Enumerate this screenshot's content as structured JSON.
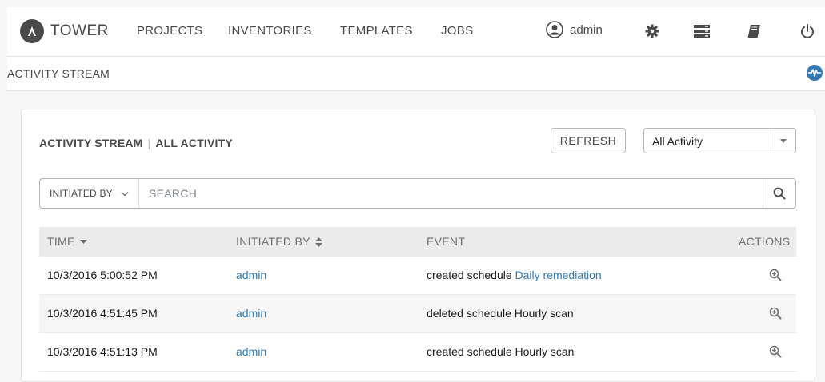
{
  "nav": {
    "brand": "TOWER",
    "links": [
      "PROJECTS",
      "INVENTORIES",
      "TEMPLATES",
      "JOBS"
    ],
    "user": "admin",
    "icons": [
      "settings-gear-icon",
      "server-stack-icon",
      "docs-book-icon",
      "power-icon"
    ]
  },
  "breadcrumb": {
    "label": "ACTIVITY STREAM",
    "activity_icon": "activity-pulse-icon"
  },
  "panel": {
    "title": "ACTIVITY STREAM",
    "subtitle": "ALL ACTIVITY",
    "refresh_label": "REFRESH",
    "filter_value": "All Activity"
  },
  "search": {
    "key_label": "INITIATED BY",
    "placeholder": "SEARCH"
  },
  "table": {
    "headers": {
      "time": "TIME",
      "initiated_by": "INITIATED BY",
      "event": "EVENT",
      "actions": "ACTIONS"
    },
    "rows": [
      {
        "time": "10/3/2016 5:00:52 PM",
        "user": "admin",
        "event_prefix": "created schedule",
        "event_link": "Daily remediation",
        "event_suffix": ""
      },
      {
        "time": "10/3/2016 4:51:45 PM",
        "user": "admin",
        "event_prefix": "deleted schedule Hourly scan",
        "event_link": "",
        "event_suffix": ""
      },
      {
        "time": "10/3/2016 4:51:13 PM",
        "user": "admin",
        "event_prefix": "created schedule Hourly scan",
        "event_link": "",
        "event_suffix": ""
      }
    ]
  },
  "colors": {
    "link": "#337ab7",
    "text": "#161b1f",
    "muted": "#707070"
  }
}
